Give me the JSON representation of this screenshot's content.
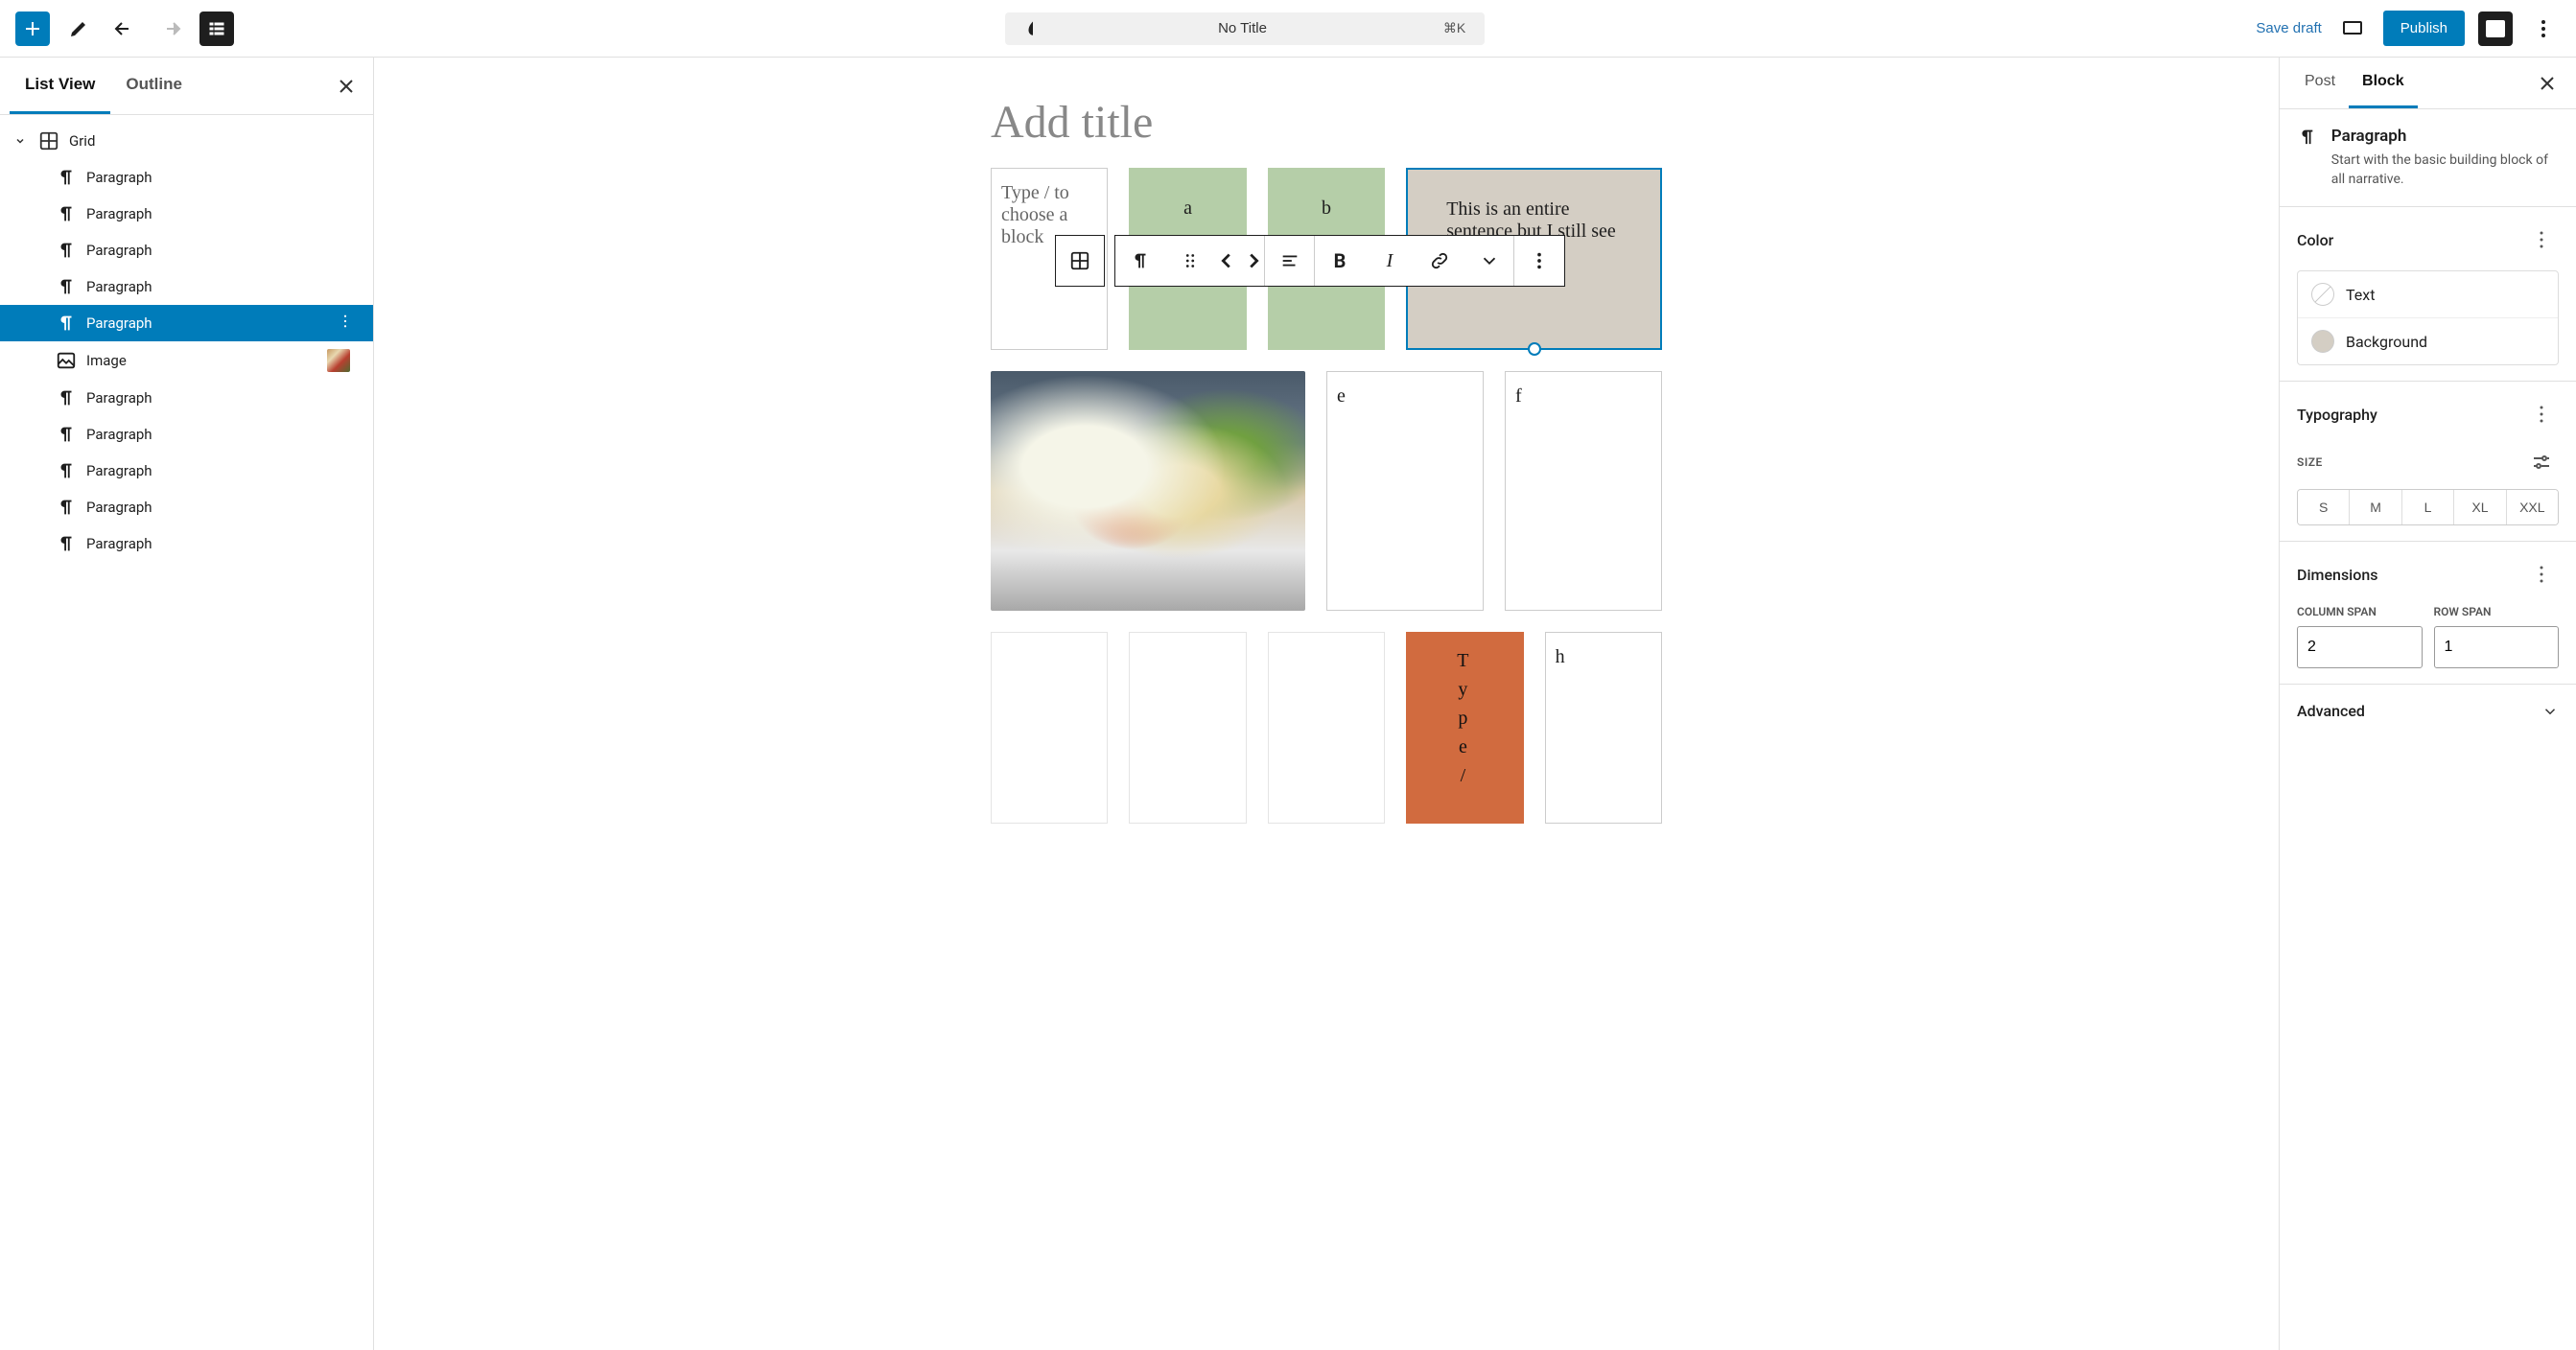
{
  "topbar": {
    "title": "No Title",
    "shortcut": "⌘K",
    "save_draft": "Save draft",
    "publish": "Publish"
  },
  "left": {
    "tabs": {
      "list_view": "List View",
      "outline": "Outline"
    },
    "tree": {
      "root": "Grid",
      "children": [
        {
          "type": "Paragraph",
          "label": "Paragraph"
        },
        {
          "type": "Paragraph",
          "label": "Paragraph"
        },
        {
          "type": "Paragraph",
          "label": "Paragraph"
        },
        {
          "type": "Paragraph",
          "label": "Paragraph"
        },
        {
          "type": "Paragraph",
          "label": "Paragraph",
          "selected": true
        },
        {
          "type": "Image",
          "label": "Image",
          "thumb": true
        },
        {
          "type": "Paragraph",
          "label": "Paragraph"
        },
        {
          "type": "Paragraph",
          "label": "Paragraph"
        },
        {
          "type": "Paragraph",
          "label": "Paragraph"
        },
        {
          "type": "Paragraph",
          "label": "Paragraph"
        },
        {
          "type": "Paragraph",
          "label": "Paragraph"
        }
      ]
    }
  },
  "canvas": {
    "title_placeholder": "Add title",
    "cells": {
      "placeholder": "Type / to choose a block",
      "a": "a",
      "b": "b",
      "selected_text": "This is an entire sentence but I still see the gap in cells",
      "e": "e",
      "f": "f",
      "h": "h",
      "orange": "T\ny\np\ne\n/"
    }
  },
  "right": {
    "tabs": {
      "post": "Post",
      "block": "Block"
    },
    "block": {
      "name": "Paragraph",
      "desc": "Start with the basic building block of all narrative."
    },
    "color": {
      "heading": "Color",
      "text": "Text",
      "background": "Background",
      "bg_value": "#d4cec4"
    },
    "typography": {
      "heading": "Typography",
      "size_label": "SIZE",
      "sizes": [
        "S",
        "M",
        "L",
        "XL",
        "XXL"
      ]
    },
    "dimensions": {
      "heading": "Dimensions",
      "col_label": "COLUMN SPAN",
      "row_label": "ROW SPAN",
      "col_value": "2",
      "row_value": "1"
    },
    "advanced": "Advanced"
  }
}
